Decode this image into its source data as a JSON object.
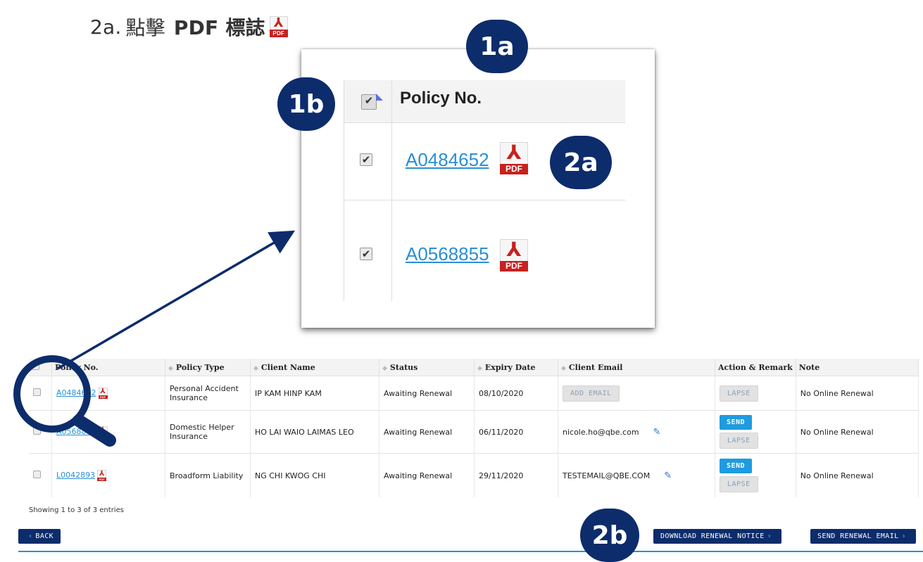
{
  "instruction": {
    "step": "2a.",
    "text_cn": "點擊",
    "text_bold": "PDF 標誌"
  },
  "badges": {
    "b1a": "1a",
    "b1b": "1b",
    "b2a": "2a",
    "b2b": "2b"
  },
  "zoom": {
    "header": "Policy No.",
    "rows": [
      {
        "policy": "A0484652",
        "checked": true
      },
      {
        "policy": "A0568855",
        "checked": true
      }
    ]
  },
  "pdf_icon": {
    "glyph": "⅄",
    "tag": "PDF"
  },
  "table": {
    "headers": [
      "Policy No.",
      "Policy Type",
      "Client Name",
      "Status",
      "Expiry Date",
      "Client Email",
      "Action & Remark",
      "Note"
    ],
    "rows": [
      {
        "policy": "A0484652",
        "policy_type": "Personal Accident Insurance",
        "client": "IP KAM HINP KAM",
        "status": "Awaiting Renewal",
        "expiry": "08/10/2020",
        "email": "",
        "email_button": "ADD EMAIL",
        "send": "",
        "lapse": "LAPSE",
        "note": "No Online Renewal"
      },
      {
        "policy": "A0568855",
        "policy_type": "Domestic Helper Insurance",
        "client": "HO LAI WAIO LAIMAS LEO",
        "status": "Awaiting Renewal",
        "expiry": "06/11/2020",
        "email": "nicole.ho@qbe.com",
        "send": "SEND",
        "lapse": "LAPSE",
        "note": "No Online Renewal"
      },
      {
        "policy": "L0042893",
        "policy_type": "Broadform Liability",
        "client": "NG CHI KWOG CHI",
        "status": "Awaiting Renewal",
        "expiry": "29/11/2020",
        "email": "TESTEMAIL@QBE.COM",
        "send": "SEND",
        "lapse": "LAPSE",
        "note": "No Online Renewal"
      }
    ],
    "footer": "Showing 1 to 3 of 3 entries"
  },
  "actions": {
    "back": "BACK",
    "download": "DOWNLOAD RENEWAL NOTICE",
    "send_email": "SEND RENEWAL EMAIL"
  },
  "colors": {
    "navy": "#0d2c6b",
    "link": "#2a8fd4",
    "send_blue": "#1f9be0",
    "pdf_red": "#c8211f"
  }
}
